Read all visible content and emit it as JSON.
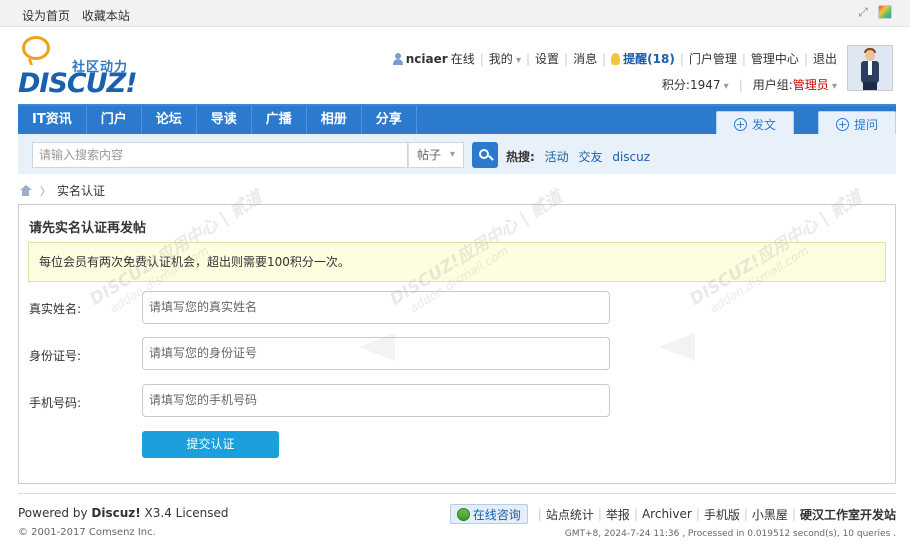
{
  "topbar": {
    "set_home": "设为首页",
    "bookmark": "收藏本站"
  },
  "logo": {
    "slogan": "社区动力",
    "brand": "DISCUZ!"
  },
  "userbar": {
    "username": "nciaer",
    "online": "在线",
    "my": "我的",
    "settings": "设置",
    "messages": "消息",
    "remind": "提醒(18)",
    "portal_manage": "门户管理",
    "admin_center": "管理中心",
    "logout": "退出",
    "credits_label": "积分: ",
    "credits_value": "1947",
    "group_label": "用户组: ",
    "group_value": "管理员"
  },
  "nav": {
    "items": [
      "IT资讯",
      "门户",
      "论坛",
      "导读",
      "广播",
      "相册",
      "分享"
    ],
    "post_button": "发文",
    "ask_button": "提问"
  },
  "search": {
    "placeholder": "请输入搜索内容",
    "type": "帖子",
    "hot_label": "热搜:",
    "hot_terms": [
      "活动",
      "交友",
      "discuz"
    ]
  },
  "breadcrumb": {
    "current": "实名认证"
  },
  "form": {
    "title": "请先实名认证再发帖",
    "notice": "每位会员有两次免费认证机会，超出则需要100积分一次。",
    "fields": [
      {
        "label": "真实姓名:",
        "placeholder": "请填写您的真实姓名"
      },
      {
        "label": "身份证号:",
        "placeholder": "请填写您的身份证号"
      },
      {
        "label": "手机号码:",
        "placeholder": "请填写您的手机号码"
      }
    ],
    "submit": "提交认证"
  },
  "watermark": {
    "text": "DISCUZ!应用中心 | 贰道",
    "sub": "addon.dismall.com"
  },
  "footer": {
    "powered_by": "Powered by ",
    "product": "Discuz!",
    "version": " X3.4 Licensed",
    "copyright": "© 2001-2017 Comsenz Inc.",
    "consult": "在线咨询",
    "stats": "站点统计",
    "report": "举报",
    "archiver": "Archiver",
    "mobile": "手机版",
    "darkroom": "小黑屋",
    "dev": "硬汉工作室开发站",
    "gmt": "GMT+8, 2024-7-24 11:36 , Processed in 0.019512 second(s), 10 queries ."
  }
}
